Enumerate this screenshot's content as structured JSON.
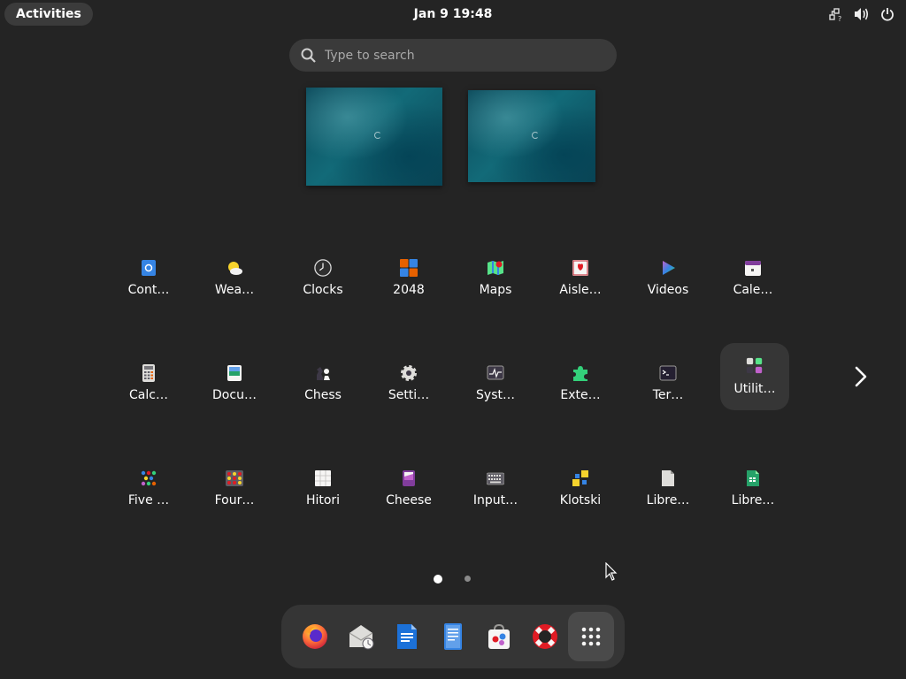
{
  "topbar": {
    "activities_label": "Activities",
    "clock": "Jan 9  19:48",
    "tray_icons": [
      "network-icon",
      "volume-icon",
      "power-icon"
    ]
  },
  "search": {
    "placeholder": "Type to search"
  },
  "workspaces": [
    "workspace-1",
    "workspace-2"
  ],
  "app_grid": {
    "page": 1,
    "page_count": 2,
    "rows": [
      [
        {
          "label": "Cont…",
          "icon": "contacts-icon"
        },
        {
          "label": "Wea…",
          "icon": "weather-icon"
        },
        {
          "label": "Clocks",
          "icon": "clocks-icon"
        },
        {
          "label": "2048",
          "icon": "2048-icon"
        },
        {
          "label": "Maps",
          "icon": "maps-icon"
        },
        {
          "label": "Aisle…",
          "icon": "aisleriot-icon"
        },
        {
          "label": "Videos",
          "icon": "videos-icon"
        },
        {
          "label": "Cale…",
          "icon": "calendar-icon"
        }
      ],
      [
        {
          "label": "Calc…",
          "icon": "calculator-icon"
        },
        {
          "label": "Docu…",
          "icon": "document-viewer-icon"
        },
        {
          "label": "Chess",
          "icon": "chess-icon"
        },
        {
          "label": "Setti…",
          "icon": "settings-icon"
        },
        {
          "label": "Syst…",
          "icon": "system-monitor-icon"
        },
        {
          "label": "Exte…",
          "icon": "extensions-icon"
        },
        {
          "label": "Ter…",
          "icon": "terminal-icon"
        },
        {
          "label": "Utilit…",
          "icon": "utilities-folder-icon"
        }
      ],
      [
        {
          "label": "Five …",
          "icon": "five-or-more-icon"
        },
        {
          "label": "Four…",
          "icon": "four-in-a-row-icon"
        },
        {
          "label": "Hitori",
          "icon": "hitori-icon"
        },
        {
          "label": "Cheese",
          "icon": "cheese-icon"
        },
        {
          "label": "Input…",
          "icon": "input-method-icon"
        },
        {
          "label": "Klotski",
          "icon": "klotski-icon"
        },
        {
          "label": "Libre…",
          "icon": "libreoffice-draw-icon"
        },
        {
          "label": "Libre…",
          "icon": "libreoffice-calc-icon"
        }
      ]
    ]
  },
  "dock": {
    "items": [
      "firefox-icon",
      "evolution-mail-icon",
      "libreoffice-writer-icon",
      "text-editor-icon",
      "software-center-icon",
      "help-icon",
      "show-apps-icon"
    ]
  },
  "colors": {
    "background": "#242424",
    "search_bg": "#3a3a3a",
    "dock_bg": "#353535",
    "highlight": "#363636"
  }
}
